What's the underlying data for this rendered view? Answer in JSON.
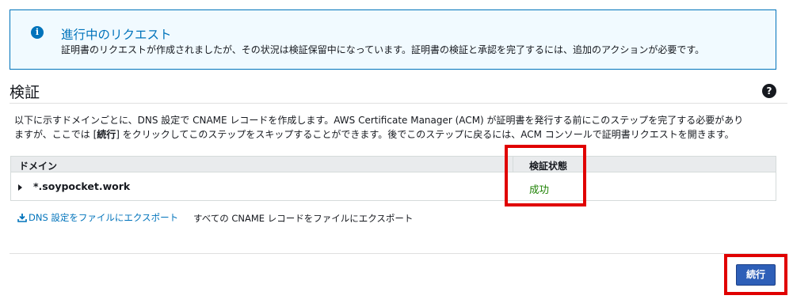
{
  "alert": {
    "icon": "info-icon",
    "title": "進行中のリクエスト",
    "body": "証明書のリクエストが作成されましたが、その状況は検証保留中になっています。証明書の検証と承認を完了するには、追加のアクションが必要です。"
  },
  "section": {
    "title": "検証",
    "help_icon": "help-icon",
    "description_line1": "以下に示すドメインごとに、DNS 設定で CNAME レコードを作成します。AWS Certificate Manager (ACM) が証明書を発行する前にこのステップを完了する必要があり",
    "description_line2_pre": "ますが、ここでは [",
    "description_line2_bold": "続行",
    "description_line2_post": "] をクリックしてこのステップをスキップすることができます。後でこのステップに戻るには、ACM コンソールで証明書リクエストを開きます。"
  },
  "table": {
    "headers": {
      "domain": "ドメイン",
      "status": "検証状態"
    },
    "rows": [
      {
        "domain": "*.soypocket.work",
        "status": "成功"
      }
    ]
  },
  "export": {
    "dns_link": "DNS 設定をファイルにエクスポート",
    "cname_text": "すべての CNAME レコードをファイルにエクスポート"
  },
  "footer": {
    "continue_label": "続行"
  },
  "colors": {
    "accent": "#0073bb",
    "success": "#1d8102",
    "highlight": "#e00000",
    "button": "#2e5fb8"
  }
}
